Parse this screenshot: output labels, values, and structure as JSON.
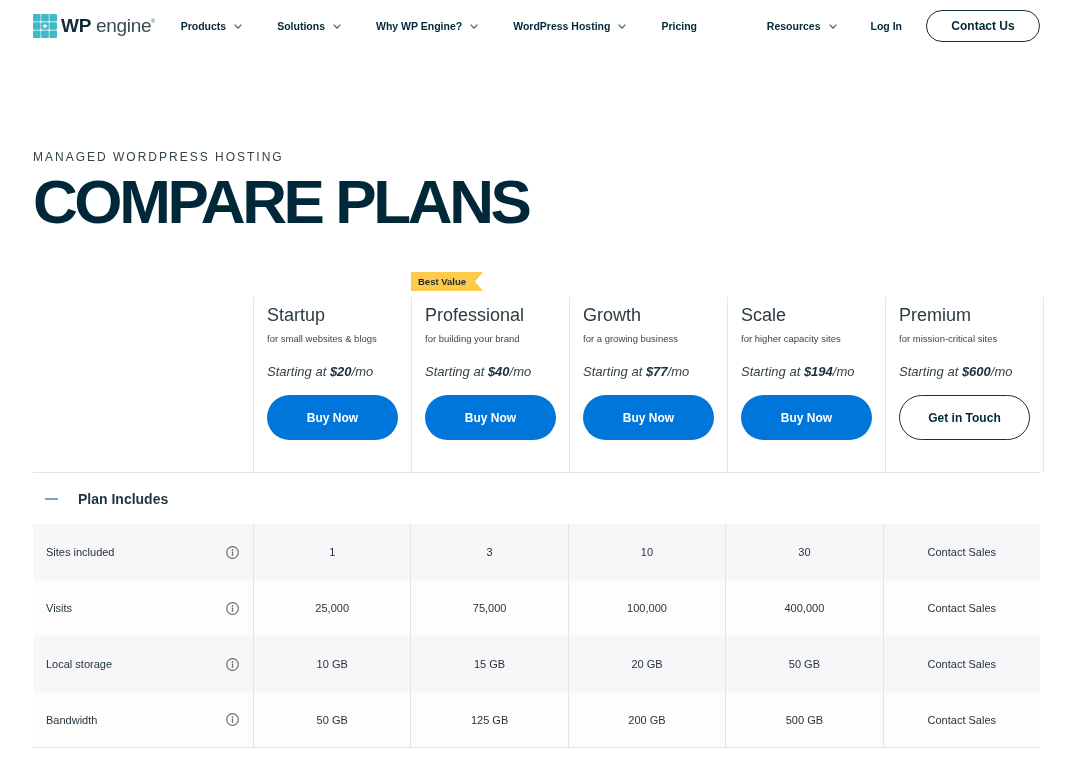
{
  "nav": {
    "logo": "**WP** engine$^{®}$",
    "links": [
      {
        "label": "Products",
        "dropdown": true
      },
      {
        "label": "Solutions",
        "dropdown": true
      },
      {
        "label": "Why WP Engine?",
        "dropdown": true
      },
      {
        "label": "WordPress Hosting",
        "dropdown": true
      },
      {
        "label": "Pricing",
        "dropdown": false
      }
    ],
    "secondary_links": [
      {
        "label": "Resources",
        "dropdown": true
      },
      {
        "label": "Log In",
        "dropdown": false
      }
    ],
    "cta": "Contact Us"
  },
  "hero": {
    "eyebrow": "MANAGED WORDPRESS HOSTING",
    "title": "COMPARE PLANS"
  },
  "plans": [
    {
      "name": "Startup",
      "description": "for small websites & blogs",
      "price": "Starting at **$20**/mo",
      "button": {
        "label": "Buy Now",
        "kind": "primary"
      }
    },
    {
      "name": "Professional",
      "badge": "Best Value",
      "description": "for building your brand",
      "price": "Starting at **$40**/mo",
      "button": {
        "label": "Buy Now",
        "kind": "primary"
      }
    },
    {
      "name": "Growth",
      "description": "for a growing business",
      "price": "Starting at **$77**/mo",
      "button": {
        "label": "Buy Now",
        "kind": "primary"
      }
    },
    {
      "name": "Scale",
      "description": "for higher capacity sites",
      "price": "Starting at **$194**/mo",
      "button": {
        "label": "Buy Now",
        "kind": "primary"
      }
    },
    {
      "name": "Premium",
      "description": "for mission-critical sites",
      "price": "Starting at **$600**/mo",
      "button": {
        "label": "Get in Touch",
        "kind": "outline"
      }
    }
  ],
  "plan_includes": {
    "title": "Plan Includes",
    "expanded": true,
    "rows": [
      {
        "name": "Sites included",
        "values": [
          "1",
          "3",
          "10",
          "30",
          "Contact Sales"
        ]
      },
      {
        "name": "Visits",
        "values": [
          "25,000",
          "75,000",
          "100,000",
          "400,000",
          "Contact Sales"
        ]
      },
      {
        "name": "Local storage",
        "values": [
          "10 GB",
          "15 GB",
          "20 GB",
          "50 GB",
          "Contact Sales"
        ]
      },
      {
        "name": "Bandwidth",
        "values": [
          "50 GB",
          "125 GB",
          "200 GB",
          "500 GB",
          "Contact Sales"
        ]
      }
    ]
  }
}
